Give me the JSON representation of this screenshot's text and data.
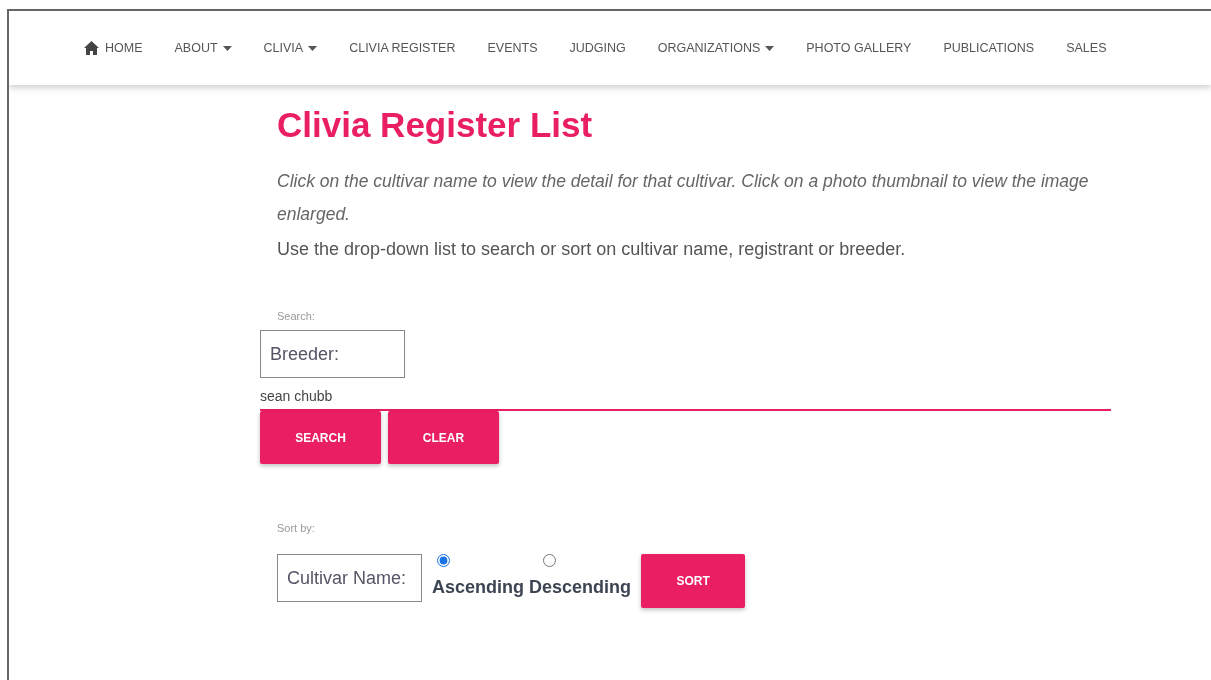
{
  "nav": {
    "items": [
      {
        "label": "HOME",
        "kind": "home",
        "dropdown": false
      },
      {
        "label": "ABOUT",
        "kind": "link",
        "dropdown": true
      },
      {
        "label": "CLIVIA",
        "kind": "link",
        "dropdown": true
      },
      {
        "label": "CLIVIA REGISTER",
        "kind": "link",
        "dropdown": false
      },
      {
        "label": "EVENTS",
        "kind": "link",
        "dropdown": false
      },
      {
        "label": "JUDGING",
        "kind": "link",
        "dropdown": false
      },
      {
        "label": "ORGANIZATIONS",
        "kind": "link",
        "dropdown": true
      },
      {
        "label": "PHOTO GALLERY",
        "kind": "link",
        "dropdown": false
      },
      {
        "label": "PUBLICATIONS",
        "kind": "link",
        "dropdown": false
      },
      {
        "label": "SALES",
        "kind": "link",
        "dropdown": false
      }
    ]
  },
  "page": {
    "title": "Clivia Register List",
    "intro": "Click on the cultivar name to view the detail for that cultivar. Click on a photo thumbnail to view the image enlarged.",
    "instructions": "Use the drop-down list to search or sort on cultivar name, registrant or breeder."
  },
  "search": {
    "label": "Search:",
    "field": "Breeder:",
    "query": "sean chubb",
    "buttons": [
      "SEARCH",
      "CLEAR"
    ]
  },
  "sort": {
    "label": "Sort by:",
    "field": "Cultivar Name:",
    "options": [
      {
        "label": "Ascending",
        "selected": true
      },
      {
        "label": "Descending",
        "selected": false
      }
    ],
    "button": "SORT"
  }
}
